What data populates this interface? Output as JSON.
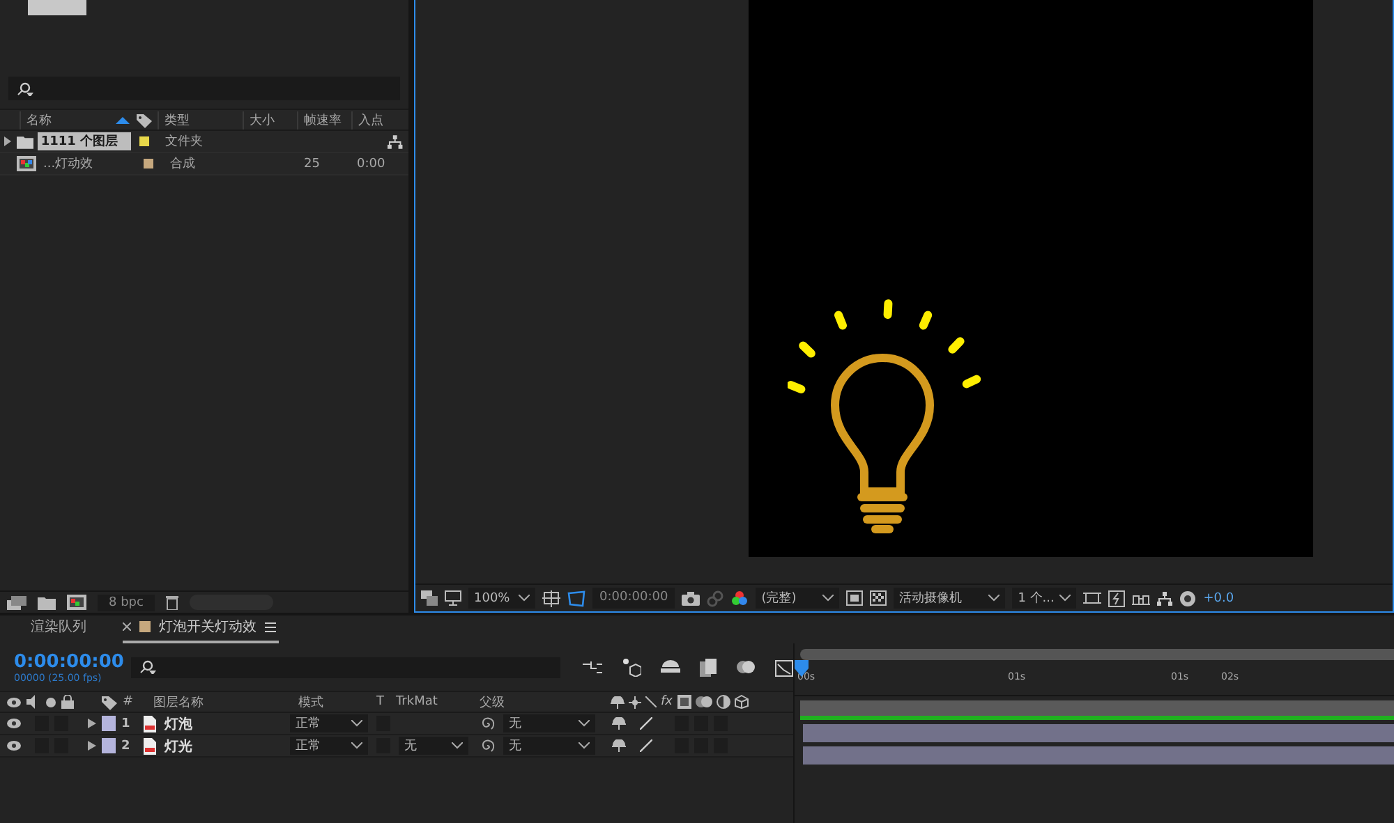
{
  "project": {
    "columns": [
      "名称",
      "类型",
      "大小",
      "帧速率",
      "入点"
    ],
    "items": [
      {
        "kind": "folder",
        "name": "1111 个图层",
        "selected": true,
        "expanded": false,
        "color": "#e8d84a",
        "type": "文件夹"
      },
      {
        "kind": "comp",
        "name": "...灯动效",
        "selected": false,
        "color": "#c6a87e",
        "type": "合成",
        "fps": "25",
        "in_point": "0:00"
      }
    ],
    "bpc": "8 bpc"
  },
  "viewer": {
    "zoom": "100%",
    "timecode": "0:00:00:00",
    "resolution": "(完整)",
    "camera": "活动摄像机",
    "views": "1 个...",
    "exposure": "+0.0"
  },
  "timeline": {
    "tabs": [
      {
        "label": "渲染队列",
        "selected": false
      },
      {
        "label": "灯泡开关灯动效",
        "selected": true,
        "color": "#c6a87e"
      }
    ],
    "time": "0:00:00:00",
    "fps": "00000 (25.00 fps)",
    "columns": {
      "number": "#",
      "name": "图层名称",
      "mode": "模式",
      "t": "T",
      "trkmat": "TrkMat",
      "parent": "父级",
      "fx": "fx"
    },
    "layers": [
      {
        "number": "1",
        "name": "灯泡",
        "color": "#b4b4dc",
        "mode": "正常",
        "parent": "无"
      },
      {
        "number": "2",
        "name": "灯光",
        "color": "#b4b4dc",
        "mode": "正常",
        "trkmat": "无",
        "parent": "无"
      }
    ],
    "ruler": [
      "00s",
      "01s",
      "01s",
      "02s"
    ]
  }
}
